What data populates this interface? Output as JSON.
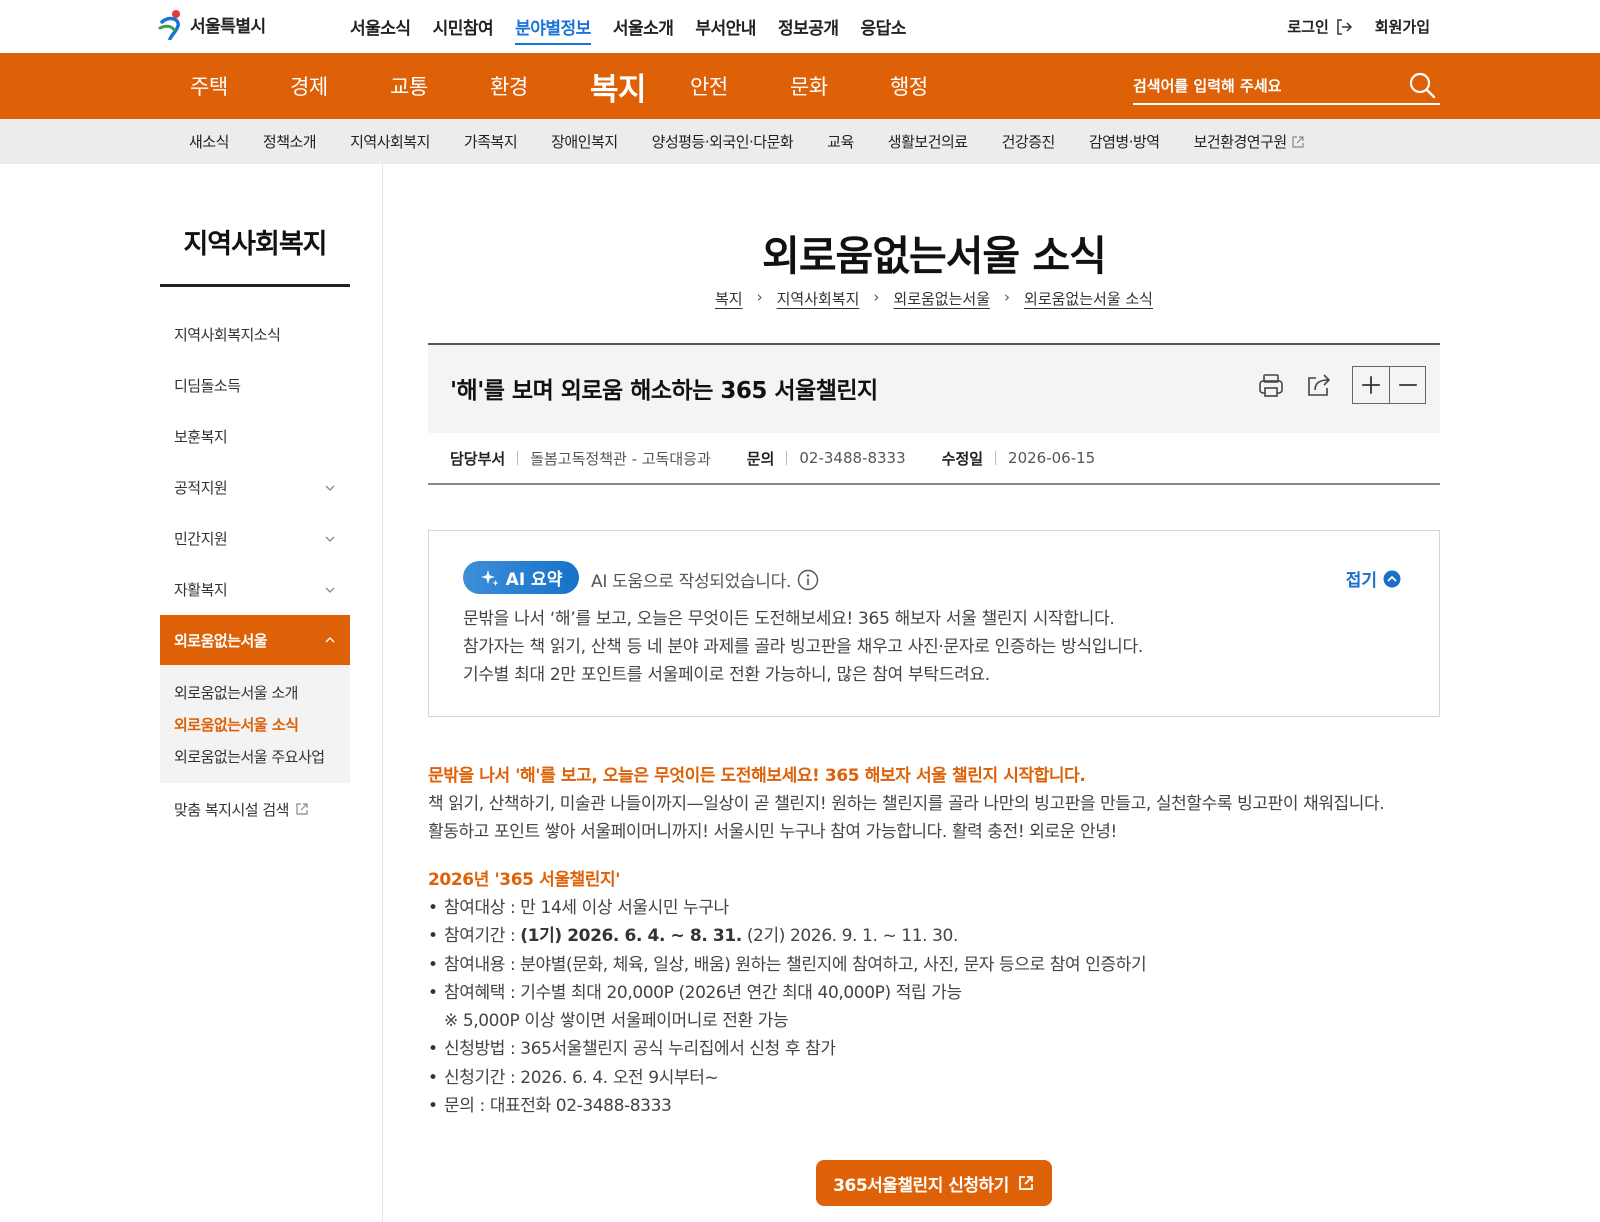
{
  "header": {
    "logo_text": "서울특별시",
    "gnb": [
      "서울소식",
      "시민참여",
      "분야별정보",
      "서울소개",
      "부서안내",
      "정보공개",
      "응답소"
    ],
    "gnb_active_index": 2,
    "login_label": "로그인",
    "signup_label": "회원가입"
  },
  "categories": {
    "items": [
      "주택",
      "경제",
      "교통",
      "환경",
      "복지",
      "안전",
      "문화",
      "행정"
    ],
    "active_index": 4,
    "search_placeholder": "검색어를 입력해 주세요"
  },
  "submenu": {
    "items": [
      "새소식",
      "정책소개",
      "지역사회복지",
      "가족복지",
      "장애인복지",
      "양성평등·외국인·다문화",
      "교육",
      "생활보건의료",
      "건강증진",
      "감염병·방역",
      "보건환경연구원"
    ]
  },
  "lnb": {
    "title": "지역사회복지",
    "items": [
      {
        "label": "지역사회복지소식"
      },
      {
        "label": "디딤돌소득"
      },
      {
        "label": "보훈복지"
      },
      {
        "label": "공적지원"
      },
      {
        "label": "민간지원"
      },
      {
        "label": "자활복지"
      },
      {
        "label": "외로움없는서울"
      }
    ],
    "subitems": [
      "외로움없는서울 소개",
      "외로움없는서울 소식",
      "외로움없는서울 주요사업"
    ],
    "external": "맞춤 복지시설 검색"
  },
  "page": {
    "title": "외로움없는서울 소식",
    "breadcrumb": [
      "복지",
      "지역사회복지",
      "외로움없는서울",
      "외로움없는서울 소식"
    ]
  },
  "article": {
    "title": "'해'를 보며 외로움 해소하는 365 서울챌린지",
    "dept_label": "담당부서",
    "dept_value": "돌봄고독정책관 - 고독대응과",
    "contact_label": "문의",
    "contact_value": "02-3488-8333",
    "modified_label": "수정일",
    "modified_value": "2026-06-15"
  },
  "ai_summary": {
    "badge": "AI 요약",
    "note": "AI 도움으로 작성되었습니다.",
    "fold_label": "접기",
    "lines": [
      "문밖을 나서 ‘해’를 보고, 오늘은 무엇이든 도전해보세요! 365 해보자 서울 챌린지 시작합니다.",
      "참가자는 책 읽기, 산책 등 네 분야 과제를 골라 빙고판을 채우고 사진·문자로 인증하는 방식입니다.",
      "기수별 최대 2만 포인트를 서울페이로 전환 가능하니, 많은 참여 부탁드려요."
    ]
  },
  "content": {
    "lead": "문밖을 나서 '해'를 보고, 오늘은 무엇이든 도전해보세요! 365 해보자 서울 챌린지 시작합니다.",
    "para1": "책 읽기, 산책하기, 미술관 나들이까지—일상이 곧 챌린지! 원하는 챌린지를 골라 나만의 빙고판을 만들고, 실천할수록 빙고판이 채워집니다.",
    "para2": "활동하고 포인트 쌓아 서울페이머니까지!  서울시민 누구나 참여 가능합니다. 활력 충전! 외로운 안녕!",
    "section_title": "2026년 '365 서울챌린지'",
    "item1": "참여대상 : 만 14세 이상 서울시민 누구나",
    "item2_prefix": "참여기간 : ",
    "item2_bold": "(1기) 2026. 6. 4. ~ 8. 31.",
    "item2_suffix": " (2기) 2026. 9. 1. ~ 11. 30.",
    "item3": "참여내용 : 분야별(문화, 체육, 일상, 배움) 원하는 챌린지에 참여하고, 사진, 문자 등으로 참여 인증하기",
    "item4": "참여혜택 : 기수별 최대 20,000P (2026년 연간 최대 40,000P) 적립 가능",
    "item4_note": "※ 5,000P 이상 쌓이면 서울페이머니로 전환 가능",
    "item5": "신청방법 : 365서울챌린지 공식 누리집에서 신청 후 참가",
    "item6": "신청기간 : 2026. 6. 4. 오전 9시부터~",
    "item7": "문의 : 대표전화 02-3488-8333",
    "apply_button": "365서울챌린지 신청하기"
  },
  "colors": {
    "brand_orange": "#de6107",
    "link_blue": "#1a73d9",
    "ai_blue": "#1672c9"
  }
}
